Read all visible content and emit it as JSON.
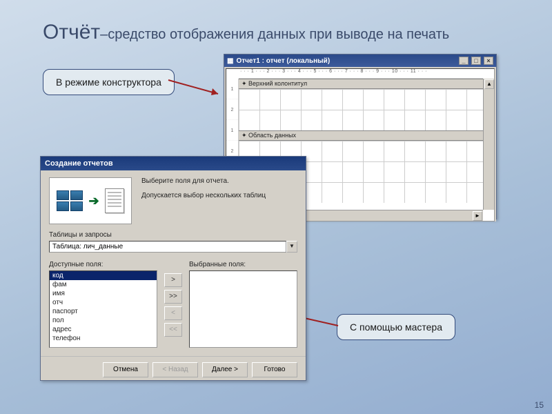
{
  "title_main": "Отчёт",
  "title_sub": "–средство отображения данных при выводе на печать",
  "callout1": "В режиме конструктора",
  "callout2": "С помощью мастера",
  "designer": {
    "title": "Отчет1 : отчет (локальный)",
    "ruler_h": "· · · 1 · · · 2 · · · 3 · · · 4 · · · 5 · · · 6 · · · 7 · · · 8 · · · 9 · · · 10 · · · 11 · · ·",
    "ruler_v": [
      "1",
      "2",
      "1",
      "2"
    ],
    "section1": "Верхний колонтитул",
    "section2": "Область данных"
  },
  "wizard": {
    "title": "Создание отчетов",
    "prompt1": "Выберите поля для отчета.",
    "prompt2": "Допускается выбор нескольких таблиц",
    "tables_label": "Таблицы и запросы",
    "combo_value": "Таблица: лич_данные",
    "avail_label": "Доступные поля:",
    "sel_label": "Выбранные поля:",
    "fields": [
      "код",
      "фам",
      "имя",
      "отч",
      "паспорт",
      "пол",
      "адрес",
      "телефон"
    ],
    "move": {
      "one": ">",
      "all": ">>",
      "back": "<",
      "back_all": "<<"
    },
    "buttons": {
      "cancel": "Отмена",
      "back": "< Назад",
      "next": "Далее >",
      "finish": "Готово"
    }
  },
  "page_no": "15"
}
